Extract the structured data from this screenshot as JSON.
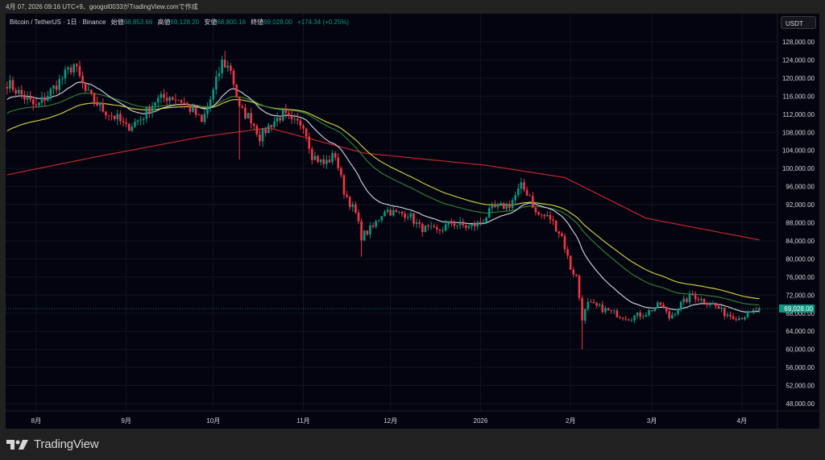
{
  "caption": "4月 07, 2026 09:16 UTC+9、googol0033がTradingView.comで作成",
  "legend": {
    "symbol": "Bitcoin / TetherUS · 1日 · Binance",
    "open_label": "始値",
    "open": "68,853.66",
    "high_label": "高値",
    "high": "69,128.20",
    "low_label": "安値",
    "low": "68,800.16",
    "close_label": "終値",
    "close": "69,028.00",
    "change": "+174.34 (+0.25%)"
  },
  "currency_button": "USDT",
  "brand": "TradingView",
  "colors": {
    "up": "#089981",
    "down": "#f23645",
    "ma_white": "#c9c9d6",
    "ma_green": "#2e7d32",
    "ma_yellow": "#c8c83c",
    "ma_red": "#c0262d",
    "bg": "#03040f"
  },
  "chart_data": {
    "type": "candlestick",
    "title": "Bitcoin / TetherUS · 1日 · Binance",
    "ylim": [
      46000,
      130000
    ],
    "y_ticks": [
      "128,000.00",
      "124,000.00",
      "120,000.00",
      "116,000.00",
      "112,000.00",
      "108,000.00",
      "104,000.00",
      "100,000.00",
      "96,000.00",
      "92,000.00",
      "88,000.00",
      "84,000.00",
      "80,000.00",
      "76,000.00",
      "72,000.00",
      "68,000.00",
      "64,000.00",
      "60,000.00",
      "56,000.00",
      "52,000.00",
      "48,000.00"
    ],
    "y_tick_values": [
      128000,
      124000,
      120000,
      116000,
      112000,
      108000,
      104000,
      100000,
      96000,
      92000,
      88000,
      84000,
      80000,
      76000,
      72000,
      68000,
      64000,
      60000,
      56000,
      52000,
      48000
    ],
    "x_ticks": [
      {
        "label": "8月",
        "day": 10
      },
      {
        "label": "9月",
        "day": 41
      },
      {
        "label": "10月",
        "day": 71
      },
      {
        "label": "11月",
        "day": 102
      },
      {
        "label": "12月",
        "day": 132
      },
      {
        "label": "2026",
        "day": 163
      },
      {
        "label": "2月",
        "day": 194
      },
      {
        "label": "3月",
        "day": 222
      },
      {
        "label": "4月",
        "day": 253
      }
    ],
    "total_days": 260,
    "last_price": 69028,
    "last_price_label": "69,028.00",
    "close_anchors": [
      [
        0,
        119000
      ],
      [
        10,
        113500
      ],
      [
        19,
        120000
      ],
      [
        23,
        123000
      ],
      [
        27,
        117000
      ],
      [
        33,
        113000
      ],
      [
        38,
        111000
      ],
      [
        41,
        109000
      ],
      [
        46,
        111000
      ],
      [
        51,
        115000
      ],
      [
        56,
        116000
      ],
      [
        60,
        115000
      ],
      [
        65,
        112000
      ],
      [
        67,
        110000
      ],
      [
        71,
        117000
      ],
      [
        74,
        123500
      ],
      [
        77,
        122000
      ],
      [
        80,
        113000
      ],
      [
        84,
        111000
      ],
      [
        87,
        107000
      ],
      [
        91,
        110000
      ],
      [
        95,
        112000
      ],
      [
        98,
        110000
      ],
      [
        102,
        110000
      ],
      [
        105,
        103000
      ],
      [
        109,
        101000
      ],
      [
        113,
        103000
      ],
      [
        116,
        95000
      ],
      [
        120,
        90000
      ],
      [
        122,
        85000
      ],
      [
        126,
        87000
      ],
      [
        130,
        91000
      ],
      [
        134,
        90000
      ],
      [
        138,
        90000
      ],
      [
        142,
        87000
      ],
      [
        148,
        86000
      ],
      [
        153,
        88000
      ],
      [
        159,
        87000
      ],
      [
        163,
        88000
      ],
      [
        167,
        91000
      ],
      [
        173,
        92000
      ],
      [
        177,
        96000
      ],
      [
        180,
        94000
      ],
      [
        182,
        90000
      ],
      [
        187,
        89000
      ],
      [
        191,
        85000
      ],
      [
        194,
        78000
      ],
      [
        196,
        76000
      ],
      [
        198,
        67000
      ],
      [
        200,
        70000
      ],
      [
        205,
        69000
      ],
      [
        209,
        68000
      ],
      [
        214,
        67000
      ],
      [
        220,
        68000
      ],
      [
        225,
        70000
      ],
      [
        228,
        67000
      ],
      [
        232,
        70000
      ],
      [
        236,
        72000
      ],
      [
        239,
        71000
      ],
      [
        243,
        70000
      ],
      [
        247,
        68000
      ],
      [
        252,
        67000
      ],
      [
        256,
        68000
      ],
      [
        259,
        69028
      ]
    ],
    "ma_red_anchors": [
      [
        0,
        98600
      ],
      [
        30,
        102500
      ],
      [
        67,
        107000
      ],
      [
        90,
        109000
      ],
      [
        123,
        103400
      ],
      [
        165,
        100700
      ],
      [
        192,
        98000
      ],
      [
        220,
        89000
      ],
      [
        259,
        84200
      ]
    ],
    "ema_periods": {
      "white": 20,
      "green": 45,
      "yellow": 60
    },
    "ema_seeds": {
      "white": 115000,
      "green": 112000,
      "yellow": 108000
    }
  }
}
